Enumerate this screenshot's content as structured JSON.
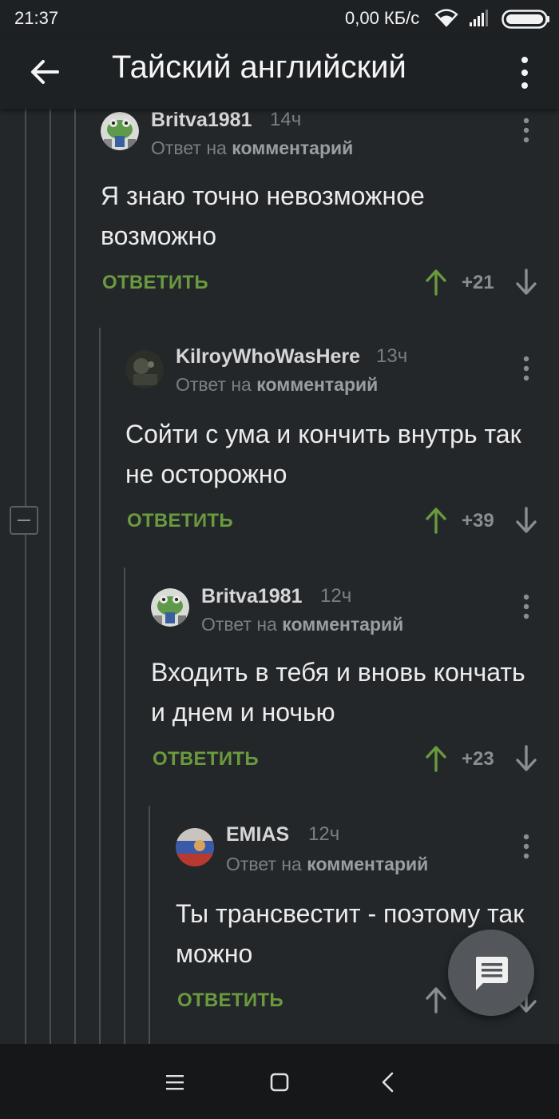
{
  "status_bar": {
    "time": "21:37",
    "net_speed": "0,00 КБ/с",
    "icons": [
      "wifi-icon",
      "signal-icon",
      "battery-icon"
    ]
  },
  "app_bar": {
    "title": "Тайский английский",
    "back_icon": "arrow-left-icon",
    "menu_icon": "more-vertical-icon"
  },
  "colors": {
    "background": "#24272a",
    "bar": "#1e2124",
    "accent_green": "#6a9a3e",
    "muted": "#7b7f83"
  },
  "comments": [
    {
      "author": "Britva1981",
      "time": "14ч",
      "reply_prefix": "Ответ на",
      "reply_target": "комментарий",
      "text": "Я знаю точно невозможное возможно",
      "reply_label": "ОТВЕТИТЬ",
      "score": "+21",
      "avatar": "frog-avatar"
    },
    {
      "author": "KilroyWhoWasHere",
      "time": "13ч",
      "reply_prefix": "Ответ на",
      "reply_target": "комментарий",
      "text": "Сойти с ума и кончить внутрь так не осторожно",
      "reply_label": "ОТВЕТИТЬ",
      "score": "+39",
      "avatar": "dark-photo-avatar"
    },
    {
      "author": "Britva1981",
      "time": "12ч",
      "reply_prefix": "Ответ на",
      "reply_target": "комментарий",
      "text": "Входить в тебя и вновь кончать и днем и ночью",
      "reply_label": "ОТВЕТИТЬ",
      "score": "+23",
      "avatar": "frog-avatar"
    },
    {
      "author": "EMIAS",
      "time": "12ч",
      "reply_prefix": "Ответ на",
      "reply_target": "комментарий",
      "text": "Ты трансвестит - поэтому так можно",
      "reply_label": "ОТВЕТИТЬ",
      "score": "",
      "avatar": "flag-avatar"
    }
  ],
  "fab_icon": "comment-icon",
  "nav_bar": [
    "menu-icon",
    "home-square-icon",
    "back-chevron-icon"
  ]
}
